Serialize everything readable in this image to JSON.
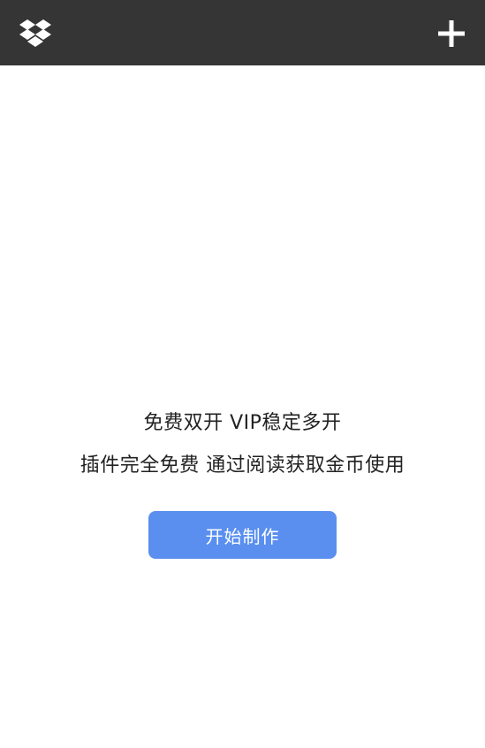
{
  "topbar": {
    "background": "#353535",
    "left_icon": "dropbox-logo-icon",
    "right_icon": "add-icon"
  },
  "main": {
    "line1": "免费双开 VIP稳定多开",
    "line2": "插件完全免费 通过阅读获取金币使用",
    "start_button_label": "开始制作",
    "accent": "#5a8ff0"
  }
}
